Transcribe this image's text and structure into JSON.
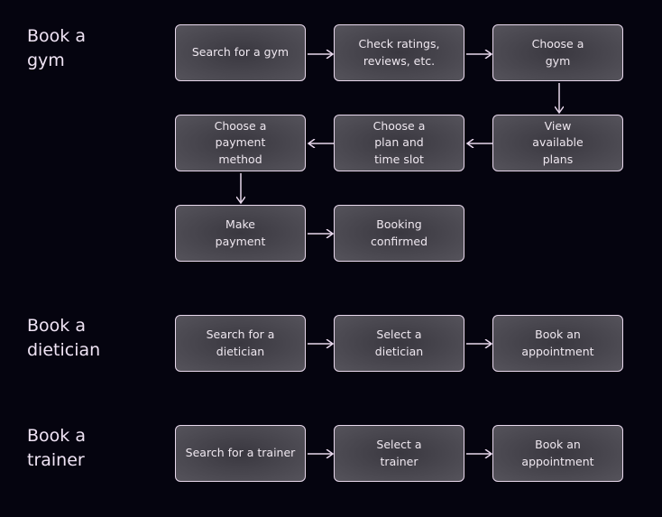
{
  "sections": [
    {
      "title": "Book a gym",
      "steps": [
        "Search for a gym",
        "Check ratings, reviews, etc.",
        "Choose a gym",
        "View available plans",
        "Choose a plan and time slot",
        "Choose a payment method",
        "Make payment",
        "Booking confirmed"
      ]
    },
    {
      "title": "Book a dietician",
      "steps": [
        "Search for a dietician",
        "Select a dietician",
        "Book an appointment"
      ]
    },
    {
      "title": "Book a trainer",
      "steps": [
        "Search for a trainer",
        "Select a trainer",
        "Book an appointment"
      ]
    }
  ],
  "labels": {
    "gym_title_1": "Book a",
    "gym_title_2": "gym",
    "diet_title_1": "Book a",
    "diet_title_2": "dietician",
    "trainer_title_1": "Book a",
    "trainer_title_2": "trainer"
  },
  "colors": {
    "background": "#05040f",
    "border": "#e8d8ec",
    "text": "#efe8f0"
  }
}
